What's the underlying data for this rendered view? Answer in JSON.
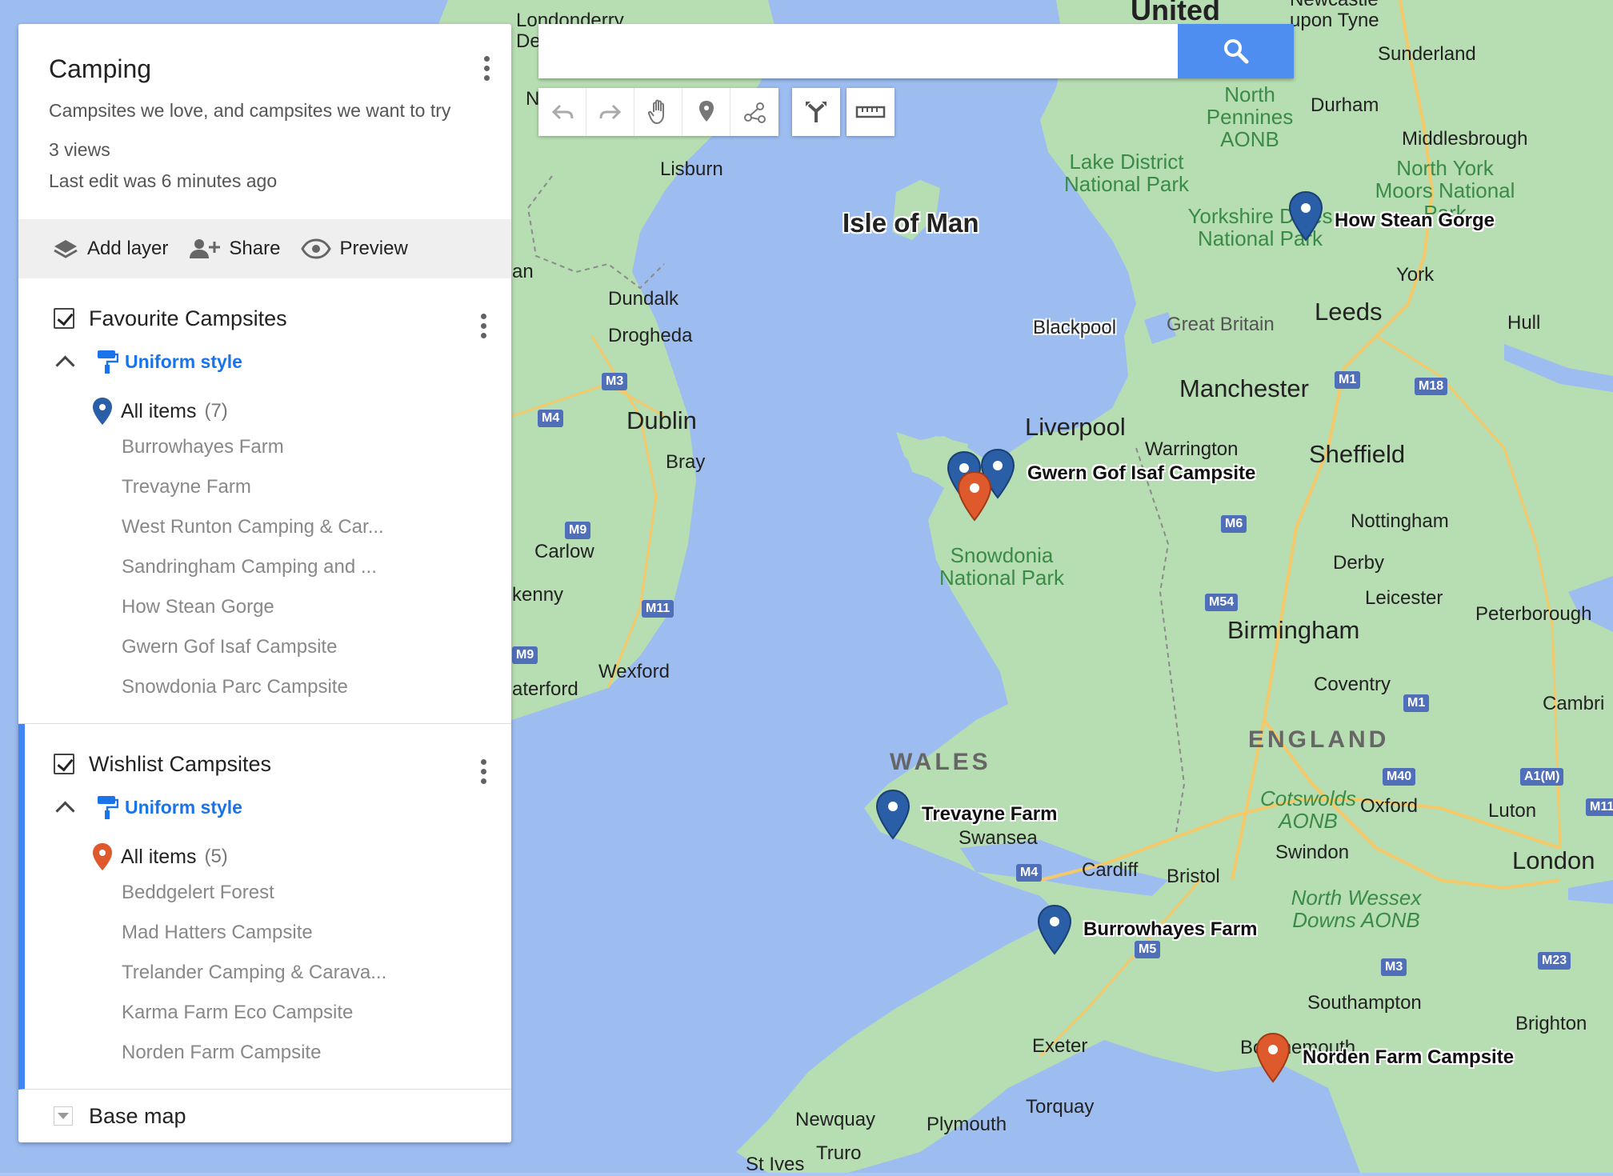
{
  "map": {
    "title": "Camping",
    "description": "Campsites we love, and campsites we want to try",
    "views": "3 views",
    "last_edit": "Last edit was 6 minutes ago"
  },
  "actions": {
    "add_layer": "Add layer",
    "share": "Share",
    "preview": "Preview"
  },
  "layers": [
    {
      "name": "Favourite Campsites",
      "style": "Uniform style",
      "all_items_label": "All items",
      "count": "(7)",
      "pin_color": "#2a5ea6",
      "items": [
        "Burrowhayes Farm",
        "Trevayne Farm",
        "West Runton Camping & Car...",
        "Sandringham Camping and ...",
        "How Stean Gorge",
        "Gwern Gof Isaf Campsite",
        "Snowdonia Parc Campsite"
      ]
    },
    {
      "name": "Wishlist Campsites",
      "style": "Uniform style",
      "all_items_label": "All items",
      "count": "(5)",
      "pin_color": "#de5a2d",
      "items": [
        "Beddgelert Forest",
        "Mad Hatters Campsite",
        "Trelander Camping & Carava...",
        "Karma Farm Eco Campsite",
        "Norden Farm Campsite"
      ]
    }
  ],
  "base_map": "Base map",
  "search": {
    "value": "",
    "placeholder": ""
  },
  "map_labels": {
    "places": [
      "Londonderry",
      "Lisburn",
      "Dundalk",
      "Drogheda",
      "Dublin",
      "Bray",
      "Carlow",
      "Wexford",
      "aterford",
      "Isle of Man",
      "Blackpool",
      "Great Britain",
      "Liverpool",
      "Warrington",
      "Manchester",
      "Leeds",
      "Sheffield",
      "York",
      "Hull",
      "Durham",
      "Sunderland",
      "Middlesbrough",
      "Nottingham",
      "Derby",
      "Leicester",
      "Peterborough",
      "Birmingham",
      "Coventry",
      "Cambri",
      "Oxford",
      "Luton",
      "London",
      "Swindon",
      "Bristol",
      "Cardiff",
      "Swansea",
      "Exeter",
      "Torquay",
      "Plymouth",
      "Newquay",
      "Truro",
      "St Ives",
      "Southampton",
      "Brighton",
      "Bournemouth",
      "United",
      "Newcastle",
      "upon Tyne",
      "an",
      "kenny",
      "De",
      "N"
    ],
    "regions": [
      "WALES",
      "ENGLAND"
    ],
    "parks": [
      "North Pennines AONB",
      "Lake District National Park",
      "North York Moors National Park",
      "Yorkshire Dales National Park",
      "Snowdonia National Park",
      "Cotswolds AONB",
      "North Wessex Downs AONB"
    ],
    "roads": [
      "M3",
      "M4",
      "M9",
      "M11",
      "M9",
      "M1",
      "M18",
      "M6",
      "M54",
      "M1",
      "M40",
      "A1(M)",
      "M11",
      "M4",
      "M5",
      "M3",
      "M23"
    ],
    "pin_labels": [
      "How Stean Gorge",
      "Gwern Gof Isaf Campsite",
      "Trevayne Farm",
      "Burrowhayes Farm",
      "Norden Farm Campsite"
    ]
  },
  "icons": {
    "search": "search-icon",
    "undo": "undo-icon",
    "redo": "redo-icon",
    "hand": "hand-icon",
    "marker": "add-marker-icon",
    "line": "draw-line-icon",
    "directions": "directions-icon",
    "ruler": "ruler-icon"
  }
}
